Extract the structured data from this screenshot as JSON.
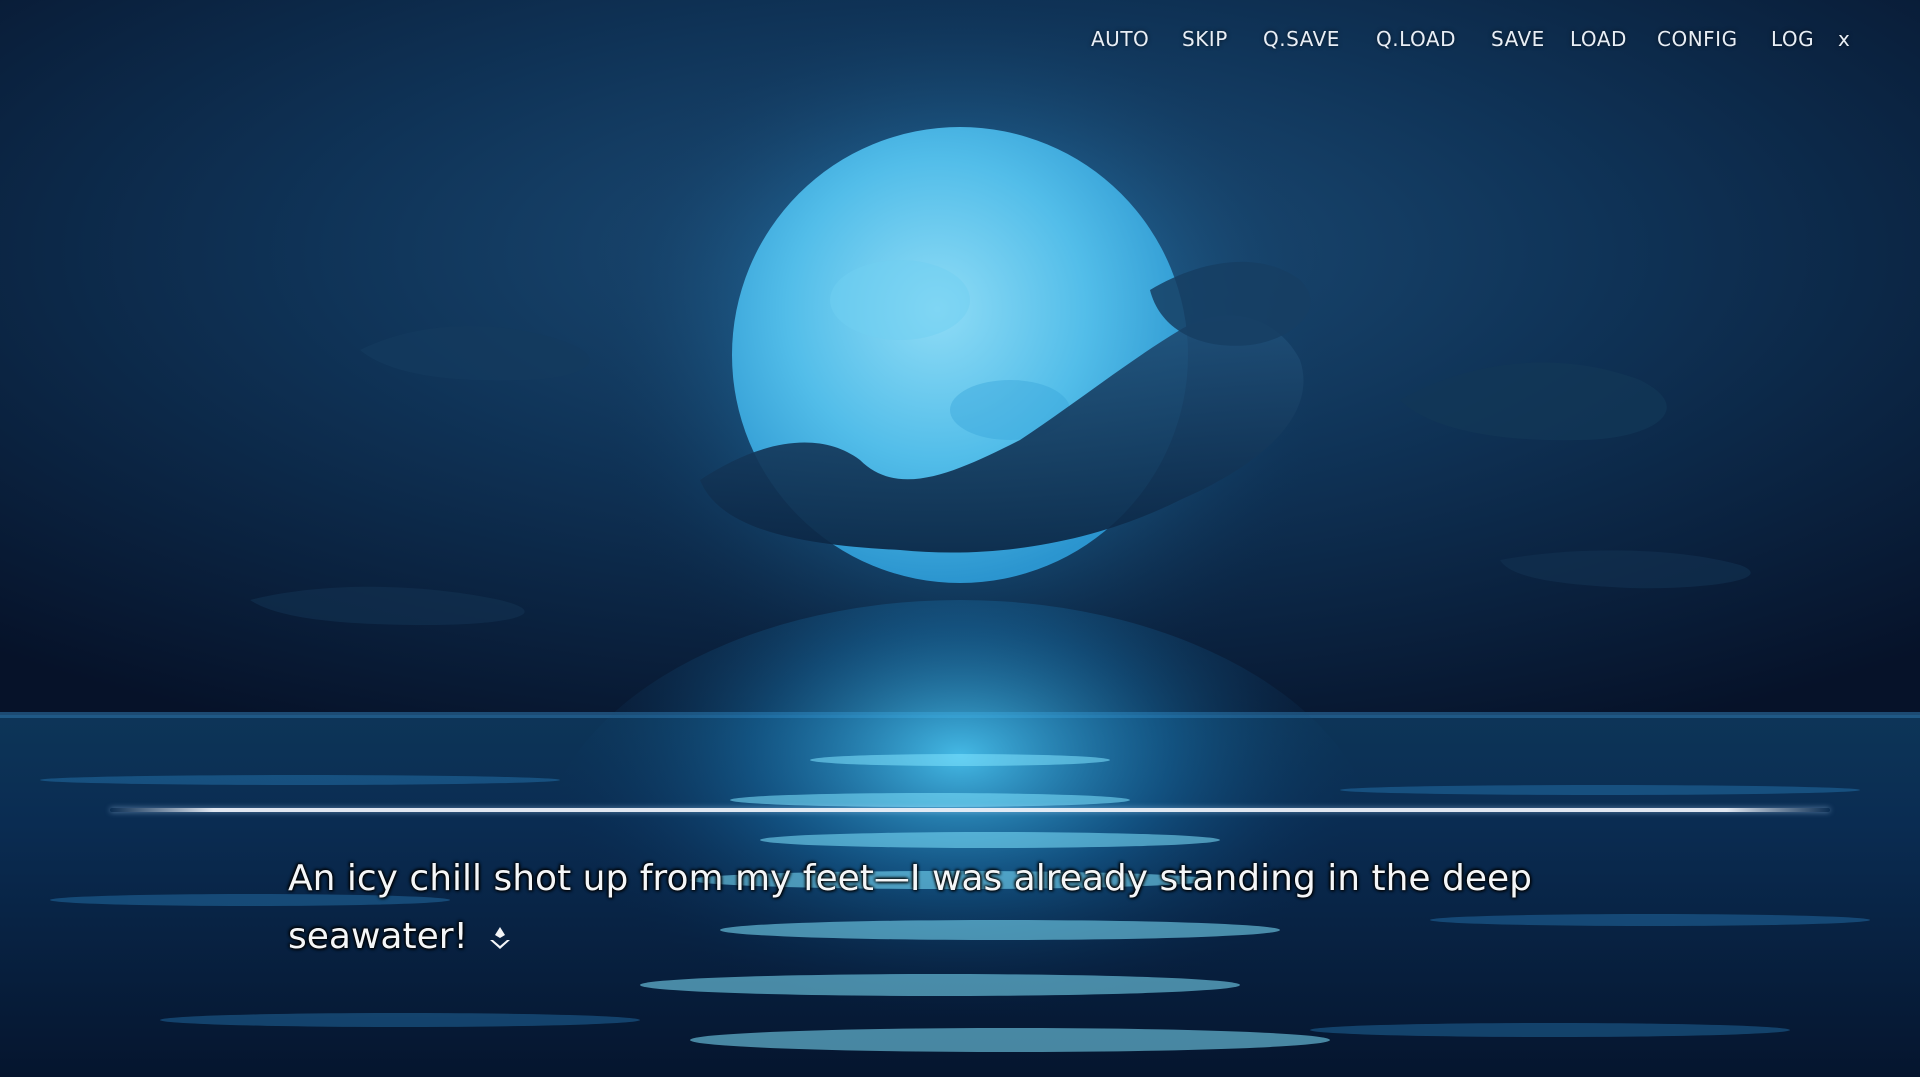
{
  "menu": {
    "items": [
      "AUTO",
      "SKIP",
      "Q.SAVE",
      "Q.LOAD",
      "SAVE",
      "LOAD",
      "CONFIG",
      "LOG"
    ],
    "close_label": "x"
  },
  "dialogue": {
    "text": "An icy chill shot up from my feet—I was already standing in the deep seawater!"
  },
  "colors": {
    "sky": "#0b2a4a",
    "moon": "#5ec8f0",
    "sea_glow": "#2fb6ea",
    "text": "#f4f6f8"
  },
  "icons": {
    "advance": "diamond-arrow-advance-icon"
  }
}
